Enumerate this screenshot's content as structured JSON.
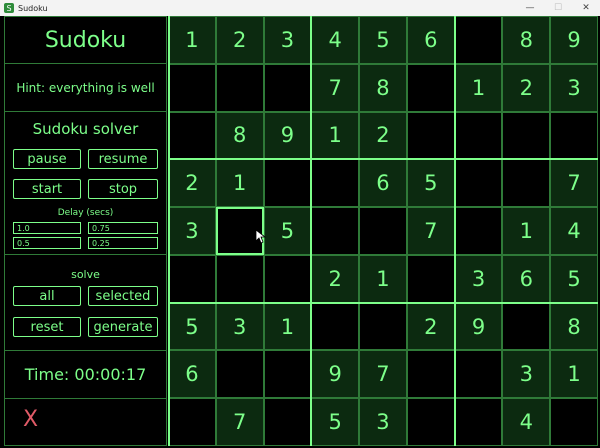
{
  "window": {
    "title": "Sudoku",
    "minimize": "—",
    "maximize": "☐",
    "close": "✕"
  },
  "panel": {
    "title": "Sudoku",
    "hint": "Hint: everything is well",
    "solver_title": "Sudoku solver",
    "buttons": {
      "pause": "pause",
      "resume": "resume",
      "start": "start",
      "stop": "stop"
    },
    "delay_label": "Delay (secs)",
    "delay_options": [
      "1.0",
      "0.75",
      "0.5",
      "0.25"
    ],
    "solve_label": "solve",
    "solve_buttons": {
      "all": "all",
      "selected": "selected",
      "reset": "reset",
      "generate": "generate"
    },
    "time": "Time: 00:00:17",
    "exit_symbol": "X"
  },
  "colors": {
    "accent": "#7dff8a",
    "grid_line": "#2f7a38",
    "given_bg": "#0c2a10",
    "exit": "#e05a67",
    "background": "#000000"
  },
  "board": {
    "selected_cell": [
      4,
      1
    ],
    "rows": [
      [
        "1",
        "2",
        "3",
        "4",
        "5",
        "6",
        "",
        "8",
        "9"
      ],
      [
        "",
        "",
        "",
        "7",
        "8",
        "",
        "1",
        "2",
        "3"
      ],
      [
        "",
        "8",
        "9",
        "1",
        "2",
        "",
        "",
        "",
        ""
      ],
      [
        "2",
        "1",
        "",
        "",
        "6",
        "5",
        "",
        "",
        "7"
      ],
      [
        "3",
        "",
        "5",
        "",
        "",
        "7",
        "",
        "1",
        "4"
      ],
      [
        "",
        "",
        "",
        "2",
        "1",
        "",
        "3",
        "6",
        "5"
      ],
      [
        "5",
        "3",
        "1",
        "",
        "",
        "2",
        "9",
        "",
        "8"
      ],
      [
        "6",
        "",
        "",
        "9",
        "7",
        "",
        "",
        "3",
        "1"
      ],
      [
        "",
        "7",
        "",
        "5",
        "3",
        "",
        "",
        "4",
        ""
      ]
    ],
    "given": [
      [
        1,
        1,
        1,
        1,
        1,
        1,
        0,
        1,
        1
      ],
      [
        0,
        0,
        0,
        1,
        1,
        0,
        1,
        1,
        1
      ],
      [
        0,
        1,
        1,
        1,
        1,
        0,
        0,
        0,
        0
      ],
      [
        1,
        1,
        0,
        0,
        1,
        1,
        0,
        0,
        1
      ],
      [
        1,
        0,
        1,
        0,
        0,
        1,
        0,
        1,
        1
      ],
      [
        0,
        0,
        0,
        1,
        1,
        0,
        1,
        1,
        1
      ],
      [
        1,
        1,
        1,
        0,
        0,
        1,
        1,
        0,
        1
      ],
      [
        1,
        0,
        0,
        1,
        1,
        0,
        0,
        1,
        1
      ],
      [
        0,
        1,
        0,
        1,
        1,
        0,
        0,
        1,
        0
      ]
    ]
  }
}
